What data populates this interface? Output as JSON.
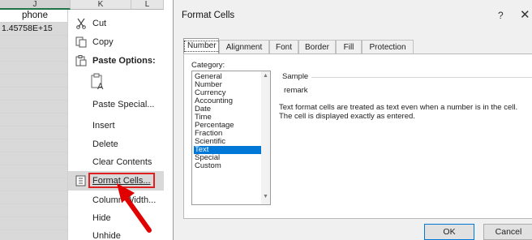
{
  "sheet": {
    "columns": [
      "J",
      "K",
      "L"
    ],
    "header_cell": "phone",
    "value_cell": "1.45758E+15"
  },
  "context_menu": {
    "items": [
      {
        "label": "Cut",
        "icon": "scissors-icon"
      },
      {
        "label": "Copy",
        "icon": "copy-icon"
      },
      {
        "label": "Paste Options:",
        "icon": "paste-icon"
      },
      {
        "label": "",
        "icon": "paste-text-icon"
      },
      {
        "label": "Paste Special..."
      },
      {
        "label": "Insert"
      },
      {
        "label": "Delete"
      },
      {
        "label": "Clear Contents"
      },
      {
        "label": "Format Cells...",
        "icon": "format-cells-icon"
      },
      {
        "label": "Column Width..."
      },
      {
        "label": "Hide"
      },
      {
        "label": "Unhide"
      }
    ],
    "highlighted": "Format Cells...",
    "highlight_color": "#e02020"
  },
  "dialog": {
    "title": "Format Cells",
    "help": "?",
    "close": "✕",
    "tabs": [
      "Number",
      "Alignment",
      "Font",
      "Border",
      "Fill",
      "Protection"
    ],
    "active_tab": "Number",
    "category_label": "Category:",
    "categories": [
      "General",
      "Number",
      "Currency",
      "Accounting",
      "Date",
      "Time",
      "Percentage",
      "Fraction",
      "Scientific",
      "Text",
      "Special",
      "Custom"
    ],
    "selected_category": "Text",
    "sample_label": "Sample",
    "sample_value": "remark",
    "description_line1": "Text format cells are treated as text even when a number is in the cell.",
    "description_line2": "The cell is displayed exactly as entered.",
    "ok_label": "OK",
    "cancel_label": "Cancel",
    "accent": "#0078d7"
  }
}
